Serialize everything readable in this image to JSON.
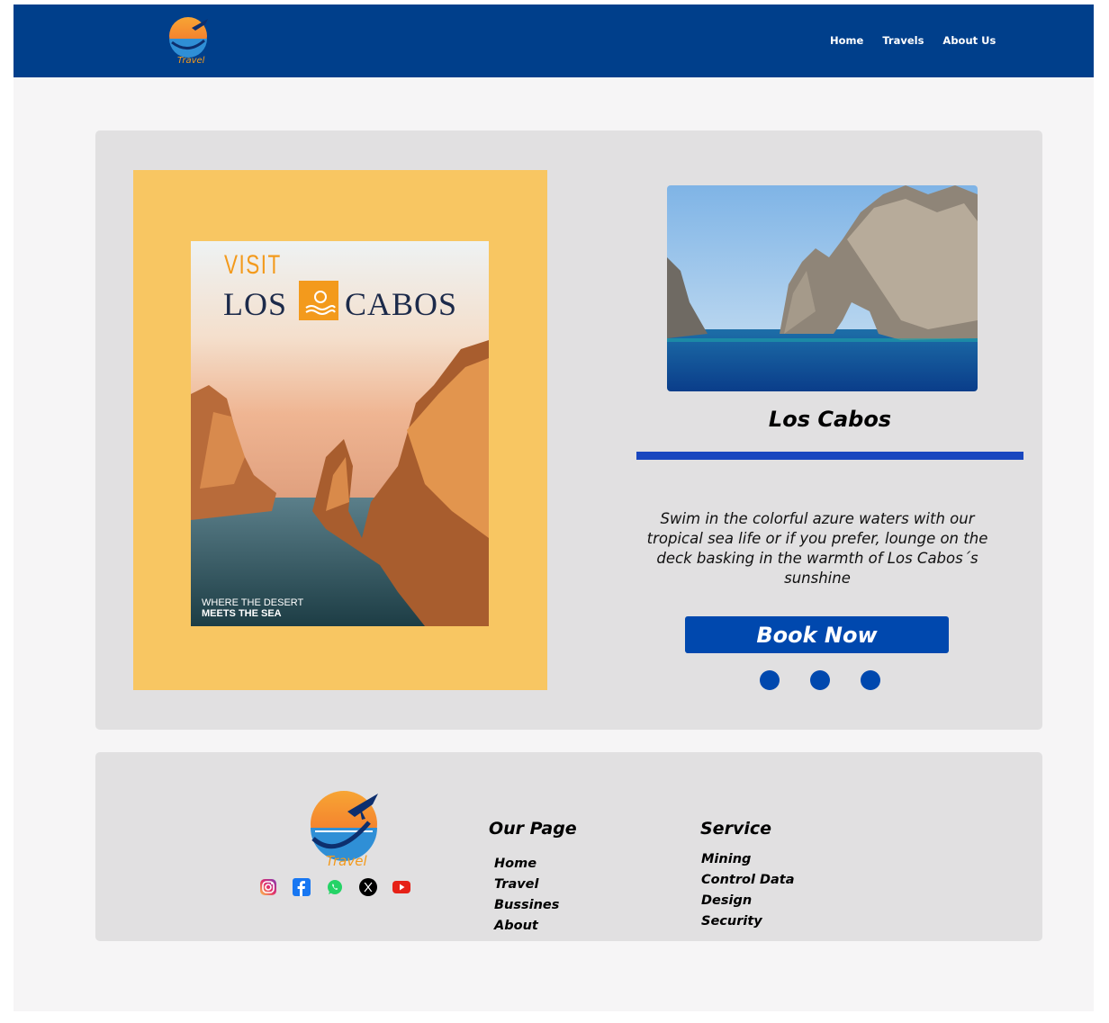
{
  "header": {
    "logo_text": "Travel",
    "nav": [
      "Home",
      "Travels",
      "About Us"
    ]
  },
  "poster": {
    "visit": "VISIT",
    "title_left": "LOS",
    "title_right": "CABOS",
    "tagline_1": "WHERE THE DESERT",
    "tagline_2": "MEETS THE SEA"
  },
  "destination": {
    "title": "Los Cabos",
    "description": "Swim in the colorful azure waters with our tropical sea life or if you prefer, lounge on the deck basking in the warmth of Los Cabos´s sunshine",
    "button": "Book Now",
    "carousel_dots": 3
  },
  "footer": {
    "logo_text": "Travel",
    "socials": [
      "instagram-icon",
      "facebook-icon",
      "whatsapp-icon",
      "x-icon",
      "youtube-icon"
    ],
    "our_page": {
      "title": "Our Page",
      "items": [
        "Home",
        "Travel",
        "Bussines",
        "About"
      ]
    },
    "service": {
      "title": "Service",
      "items": [
        "Mining",
        "Control Data",
        "Design",
        "Security"
      ]
    }
  },
  "colors": {
    "header_bg": "#003f8b",
    "accent_blue": "#0048ae",
    "poster_frame": "#f8c662",
    "card_bg": "#e1e0e1"
  }
}
